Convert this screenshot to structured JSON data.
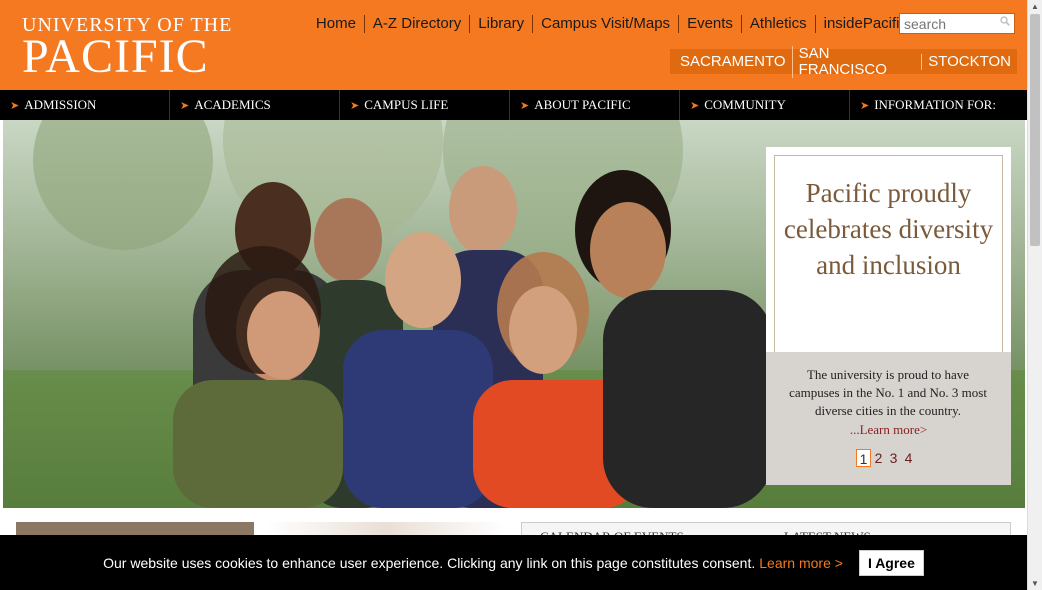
{
  "logo": {
    "line1": "UNIVERSITY OF THE",
    "line2": "PACIFIC"
  },
  "top_links": [
    "Home",
    "A-Z Directory",
    "Library",
    "Campus Visit/Maps",
    "Events",
    "Athletics",
    "insidePacific"
  ],
  "search": {
    "placeholder": "search",
    "icon": "search-icon"
  },
  "campuses": [
    "SACRAMENTO",
    "SAN FRANCISCO",
    "STOCKTON"
  ],
  "main_nav": [
    "ADMISSION",
    "ACADEMICS",
    "CAMPUS LIFE",
    "ABOUT PACIFIC",
    "COMMUNITY",
    "INFORMATION FOR:"
  ],
  "hero": {
    "title": "Pacific proudly celebrates diversity and inclusion",
    "text": "The university is proud to have campuses in the No. 1 and No. 3 most diverse cities in the country.",
    "link": "...Learn more>",
    "pages": [
      "1",
      "2",
      "3",
      "4"
    ],
    "active_page": "1"
  },
  "sections": {
    "events": "CALENDAR OF EVENTS",
    "news": "LATEST NEWS"
  },
  "cookie": {
    "message": "Our website uses cookies to enhance user experience. Clicking any link on this page constitutes consent.",
    "link": "Learn more >",
    "button": "I Agree"
  },
  "colors": {
    "brand_orange": "#f47920",
    "nav_black": "#000000",
    "promo_brown": "#7a5a3a"
  }
}
